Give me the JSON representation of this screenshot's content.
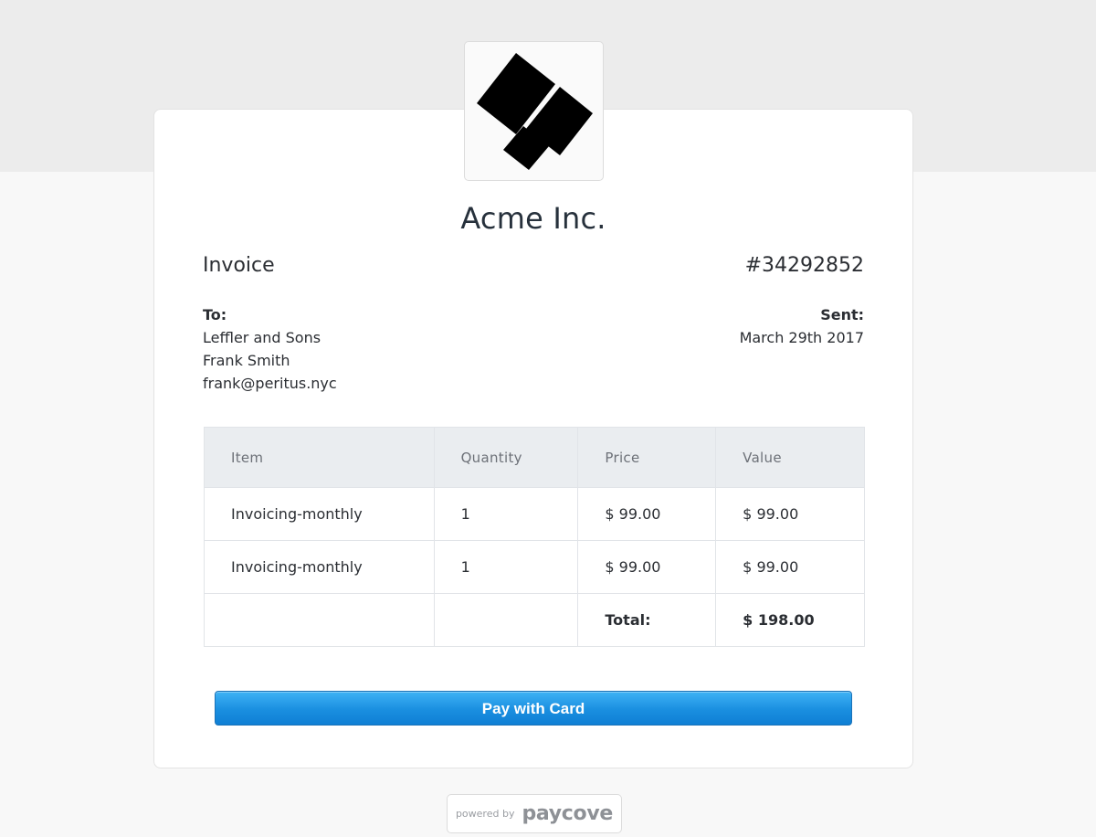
{
  "company": {
    "name": "Acme Inc.",
    "logo_icon": "acme-logo-icon"
  },
  "invoice": {
    "label": "Invoice",
    "number": "#34292852"
  },
  "recipient": {
    "label": "To:",
    "company": "Leffler and Sons",
    "name": "Frank Smith",
    "email": "frank@peritus.nyc"
  },
  "sent": {
    "label": "Sent:",
    "date": "March 29th 2017"
  },
  "table": {
    "headers": [
      "Item",
      "Quantity",
      "Price",
      "Value"
    ],
    "rows": [
      {
        "item": "Invoicing-monthly",
        "quantity": "1",
        "price": "$ 99.00",
        "value": "$ 99.00"
      },
      {
        "item": "Invoicing-monthly",
        "quantity": "1",
        "price": "$ 99.00",
        "value": "$ 99.00"
      }
    ],
    "total_label": "Total:",
    "total_value": "$ 198.00"
  },
  "pay_button": {
    "label": "Pay with Card"
  },
  "footer": {
    "powered_by": "powered by",
    "brand": "paycove"
  },
  "colors": {
    "button_top": "#3fb2f5",
    "button_bottom": "#0f7fd4",
    "header_bg": "#eaedf0",
    "text": "#2b2e33"
  }
}
